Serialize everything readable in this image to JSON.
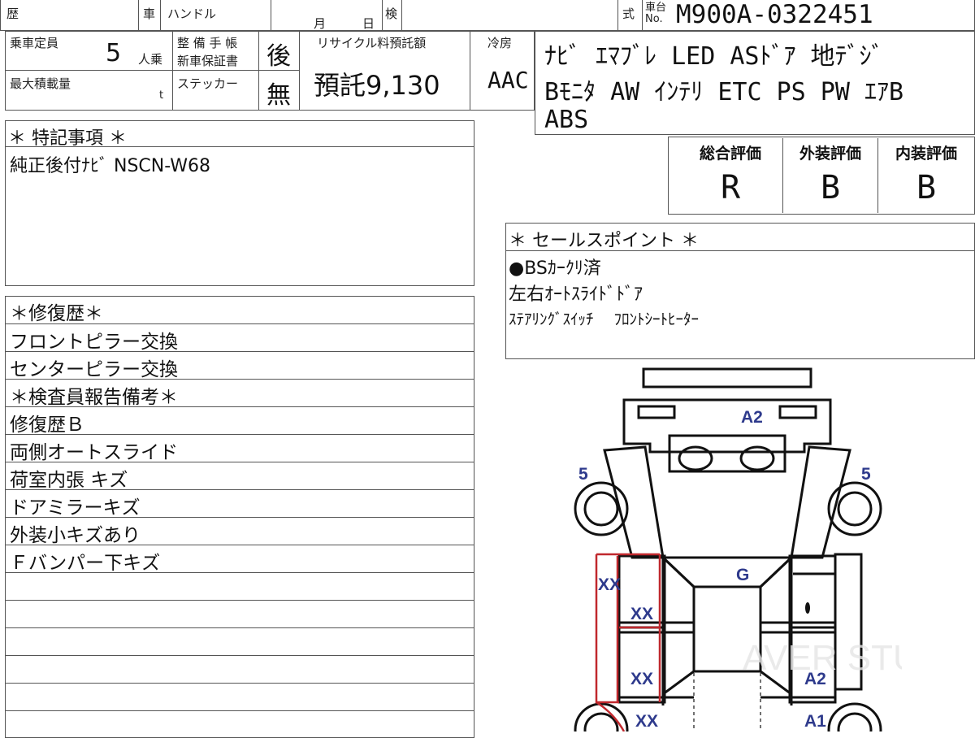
{
  "header": {
    "rireki_label": "歴",
    "sha_label": "車",
    "handle_label": "ハンドル",
    "month_label": "月",
    "day_label": "日",
    "ken_label": "検",
    "shiki_label": "式",
    "car_no_label_top": "車台",
    "car_no_label_bottom": "No.",
    "car_no": "M900A-0322451"
  },
  "capacity": {
    "label": "乗車定員",
    "value": "5",
    "unit": "人乗"
  },
  "max_load": {
    "label": "最大積載量",
    "unit": "t"
  },
  "maintenance": {
    "label": "整 備 手 帳",
    "value": "後"
  },
  "warranty": {
    "label": "新車保証書"
  },
  "sticker": {
    "label": "ステッカー",
    "value": "無"
  },
  "recycle": {
    "label": "リサイクル料預託額",
    "value": "預託9,130"
  },
  "aircon": {
    "label": "冷房",
    "value": "AAC"
  },
  "equipment": {
    "line1": "ﾅﾋﾞ ｴﾏﾌﾞﾚ LED ASﾄﾞｱ 地ﾃﾞｼﾞ",
    "line2": "Bﾓﾆﾀ AW ｲﾝﾃﾘ ETC PS PW ｴｱB",
    "line3": "ABS"
  },
  "grades": [
    {
      "label": "総合評価",
      "value": "R"
    },
    {
      "label": "外装評価",
      "value": "B"
    },
    {
      "label": "内装評価",
      "value": "B"
    }
  ],
  "special_notes": {
    "title": "＊ 特記事項 ＊",
    "text": "純正後付ﾅﾋﾞ NSCN-W68"
  },
  "sales_points": {
    "title": "＊ セールスポイント ＊",
    "items": [
      "●BSｶｰｸﾘ済",
      "左右ｵｰﾄｽﾗｲﾄﾞﾄﾞｱ",
      "ｽﾃｱﾘﾝｸﾞｽｲｯﾁ　 ﾌﾛﾝﾄｼｰﾄﾋｰﾀｰ"
    ]
  },
  "repair_history": {
    "rows": [
      "＊修復歴＊",
      "フロントピラー交換",
      "センターピラー交換",
      "＊検査員報告備考＊",
      "修復歴Ｂ",
      "両側オートスライド",
      "荷室内張 キズ",
      "ドアミラーキズ",
      "外装小キズあり",
      "Ｆバンパー下キズ",
      "",
      "",
      "",
      "",
      "",
      ""
    ]
  },
  "diagram": {
    "codes": {
      "front_bumper": "A2",
      "left_front_wheel": "5",
      "right_front_wheel": "5",
      "windshield": "G",
      "left_pillar_a": "XX",
      "left_pillar_b": "XX",
      "left_pillar_c": "XX",
      "left_rear": "XX",
      "right_door": "A2",
      "right_rear": "A1"
    },
    "watermark": "AVER STUDIO PRO",
    "code_color": "#2e3a8c",
    "repair_color": "#c0282d"
  }
}
